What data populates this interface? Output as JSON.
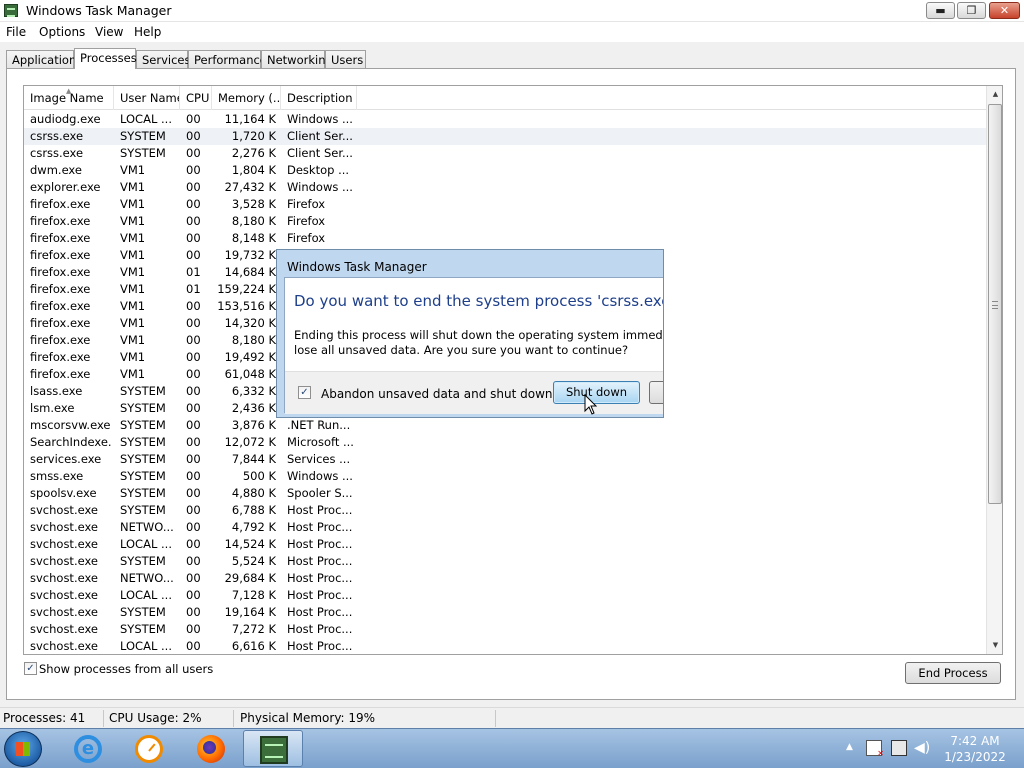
{
  "window": {
    "title": "Windows Task Manager",
    "buttons": {
      "minimize": "▬",
      "maximize": "❐",
      "close": "✕"
    }
  },
  "menu": [
    "File",
    "Options",
    "View",
    "Help"
  ],
  "tabs": [
    "Applications",
    "Processes",
    "Services",
    "Performance",
    "Networking",
    "Users"
  ],
  "active_tab": "Processes",
  "columns": [
    "Image Name",
    "User Name",
    "CPU",
    "Memory (...",
    "Description"
  ],
  "processes": [
    {
      "name": "audiodg.exe",
      "user": "LOCAL ...",
      "cpu": "00",
      "mem": "11,164 K",
      "desc": "Windows ..."
    },
    {
      "name": "csrss.exe",
      "user": "SYSTEM",
      "cpu": "00",
      "mem": "1,720 K",
      "desc": "Client Ser..."
    },
    {
      "name": "csrss.exe",
      "user": "SYSTEM",
      "cpu": "00",
      "mem": "2,276 K",
      "desc": "Client Ser..."
    },
    {
      "name": "dwm.exe",
      "user": "VM1",
      "cpu": "00",
      "mem": "1,804 K",
      "desc": "Desktop ..."
    },
    {
      "name": "explorer.exe",
      "user": "VM1",
      "cpu": "00",
      "mem": "27,432 K",
      "desc": "Windows ..."
    },
    {
      "name": "firefox.exe",
      "user": "VM1",
      "cpu": "00",
      "mem": "3,528 K",
      "desc": "Firefox"
    },
    {
      "name": "firefox.exe",
      "user": "VM1",
      "cpu": "00",
      "mem": "8,180 K",
      "desc": "Firefox"
    },
    {
      "name": "firefox.exe",
      "user": "VM1",
      "cpu": "00",
      "mem": "8,148 K",
      "desc": "Firefox"
    },
    {
      "name": "firefox.exe",
      "user": "VM1",
      "cpu": "00",
      "mem": "19,732 K",
      "desc": ""
    },
    {
      "name": "firefox.exe",
      "user": "VM1",
      "cpu": "01",
      "mem": "14,684 K",
      "desc": ""
    },
    {
      "name": "firefox.exe",
      "user": "VM1",
      "cpu": "01",
      "mem": "159,224 K",
      "desc": ""
    },
    {
      "name": "firefox.exe",
      "user": "VM1",
      "cpu": "00",
      "mem": "153,516 K",
      "desc": ""
    },
    {
      "name": "firefox.exe",
      "user": "VM1",
      "cpu": "00",
      "mem": "14,320 K",
      "desc": ""
    },
    {
      "name": "firefox.exe",
      "user": "VM1",
      "cpu": "00",
      "mem": "8,180 K",
      "desc": ""
    },
    {
      "name": "firefox.exe",
      "user": "VM1",
      "cpu": "00",
      "mem": "19,492 K",
      "desc": ""
    },
    {
      "name": "firefox.exe",
      "user": "VM1",
      "cpu": "00",
      "mem": "61,048 K",
      "desc": ""
    },
    {
      "name": "lsass.exe",
      "user": "SYSTEM",
      "cpu": "00",
      "mem": "6,332 K",
      "desc": ""
    },
    {
      "name": "lsm.exe",
      "user": "SYSTEM",
      "cpu": "00",
      "mem": "2,436 K",
      "desc": ""
    },
    {
      "name": "mscorsvw.exe",
      "user": "SYSTEM",
      "cpu": "00",
      "mem": "3,876 K",
      "desc": ".NET Run..."
    },
    {
      "name": "SearchIndexe...",
      "user": "SYSTEM",
      "cpu": "00",
      "mem": "12,072 K",
      "desc": "Microsoft ..."
    },
    {
      "name": "services.exe",
      "user": "SYSTEM",
      "cpu": "00",
      "mem": "7,844 K",
      "desc": "Services ..."
    },
    {
      "name": "smss.exe",
      "user": "SYSTEM",
      "cpu": "00",
      "mem": "500 K",
      "desc": "Windows ..."
    },
    {
      "name": "spoolsv.exe",
      "user": "SYSTEM",
      "cpu": "00",
      "mem": "4,880 K",
      "desc": "Spooler S..."
    },
    {
      "name": "svchost.exe",
      "user": "SYSTEM",
      "cpu": "00",
      "mem": "6,788 K",
      "desc": "Host Proc..."
    },
    {
      "name": "svchost.exe",
      "user": "NETWO...",
      "cpu": "00",
      "mem": "4,792 K",
      "desc": "Host Proc..."
    },
    {
      "name": "svchost.exe",
      "user": "LOCAL ...",
      "cpu": "00",
      "mem": "14,524 K",
      "desc": "Host Proc..."
    },
    {
      "name": "svchost.exe",
      "user": "SYSTEM",
      "cpu": "00",
      "mem": "5,524 K",
      "desc": "Host Proc..."
    },
    {
      "name": "svchost.exe",
      "user": "NETWO...",
      "cpu": "00",
      "mem": "29,684 K",
      "desc": "Host Proc..."
    },
    {
      "name": "svchost.exe",
      "user": "LOCAL ...",
      "cpu": "00",
      "mem": "7,128 K",
      "desc": "Host Proc..."
    },
    {
      "name": "svchost.exe",
      "user": "SYSTEM",
      "cpu": "00",
      "mem": "19,164 K",
      "desc": "Host Proc..."
    },
    {
      "name": "svchost.exe",
      "user": "SYSTEM",
      "cpu": "00",
      "mem": "7,272 K",
      "desc": "Host Proc..."
    },
    {
      "name": "svchost.exe",
      "user": "LOCAL ...",
      "cpu": "00",
      "mem": "6,616 K",
      "desc": "Host Proc..."
    }
  ],
  "selected_row": 1,
  "show_all_users": {
    "label": "Show processes from all users",
    "checked": true
  },
  "end_process_label": "End Process",
  "status": {
    "processes": "Processes: 41",
    "cpu": "CPU Usage: 2%",
    "memory": "Physical Memory: 19%"
  },
  "dialog": {
    "title": "Windows Task Manager",
    "heading": "Do you want to end the system process 'csrss.exe'?",
    "body_line1": "Ending this process will shut down the operating system immediately.",
    "body_line2": "lose all unsaved data.  Are you sure you want to continue?",
    "checkbox_label": "Abandon unsaved data and shut down.",
    "checkbox_checked": true,
    "shutdown_label": "Shut down",
    "cancel_label": "C"
  },
  "taskbar": {
    "pinned": [
      "internet-explorer",
      "clock-app",
      "firefox",
      "task-manager"
    ],
    "clock_time": "7:42 AM",
    "clock_date": "1/23/2022"
  },
  "colors": {
    "dialog_heading": "#1e3f8a",
    "selection": "#eef1f6",
    "taskbar": "#8fb2d9",
    "shutdown_button": "#a7d4f2"
  }
}
